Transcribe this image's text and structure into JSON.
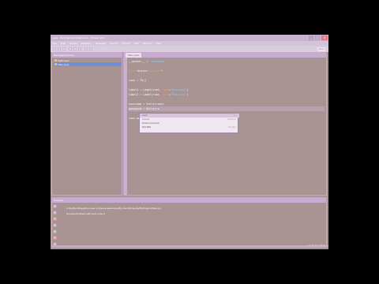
{
  "window": {
    "title": "Java - MyProject/src/Main.java - Eclipse SDK",
    "controls": [
      "_",
      "□",
      "x"
    ]
  },
  "menubar": {
    "items": [
      "File",
      "Edit",
      "Source",
      "Refactor",
      "Navigate",
      "Search",
      "Project",
      "Run",
      "Window",
      "Help"
    ]
  },
  "toolbar": {
    "perspective_label": "Java"
  },
  "package_explorer": {
    "title": "Package Explorer",
    "items": [
      {
        "label": "MyProject",
        "selected": false
      },
      {
        "label": "Main.java",
        "selected": true
      }
    ]
  },
  "editor": {
    "tab_label": "Main.java",
    "lines": [
      {
        "parts": [
          {
            "t": "   __author__ = ",
            "c": ""
          },
          {
            "t": "'username'",
            "c": "st"
          }
        ],
        "hl": false
      },
      {
        "parts": [],
        "hl": false
      },
      {
        "parts": [
          {
            "t": "from ",
            "c": "kw"
          },
          {
            "t": "tkinter ",
            "c": ""
          },
          {
            "t": "import",
            "c": "kw"
          },
          {
            "t": " *",
            "c": ""
          }
        ],
        "hl": false
      },
      {
        "parts": [],
        "hl": false
      },
      {
        "parts": [
          {
            "t": "root = Tk()",
            "c": ""
          }
        ],
        "hl": false
      },
      {
        "parts": [],
        "hl": false
      },
      {
        "parts": [
          {
            "t": "label1 = Label(root, ",
            "c": ""
          },
          {
            "t": "text",
            "c": "kw"
          },
          {
            "t": "=",
            "c": ""
          },
          {
            "t": "\"Username\"",
            "c": "st"
          },
          {
            "t": ")",
            "c": ""
          }
        ],
        "hl": false
      },
      {
        "parts": [
          {
            "t": "label2 = Label(root, ",
            "c": ""
          },
          {
            "t": "text",
            "c": "kw"
          },
          {
            "t": "=",
            "c": ""
          },
          {
            "t": "\"Password\"",
            "c": "st"
          },
          {
            "t": ")",
            "c": ""
          }
        ],
        "hl": false
      },
      {
        "parts": [],
        "hl": false
      },
      {
        "parts": [
          {
            "t": "username = Entry(root)",
            "c": ""
          }
        ],
        "hl": false
      },
      {
        "parts": [
          {
            "t": "password = Entry(ro",
            "c": ""
          }
        ],
        "hl": true
      },
      {
        "parts": [],
        "hl": false
      },
      {
        "parts": [
          {
            "t": "root.mainloop()",
            "c": ""
          }
        ],
        "hl": false
      }
    ]
  },
  "autocomplete": {
    "items": [
      {
        "label": "root",
        "hint": "Tk",
        "selected": true
      },
      {
        "label": "round",
        "hint": "builtins",
        "selected": false
      },
      {
        "label": "RowConstraint",
        "hint": "",
        "selected": false
      },
      {
        "label": "ROUND",
        "hint": "tkinter",
        "selected": false
      }
    ]
  },
  "console": {
    "title": "Console",
    "lines": [
      "C:\\Python34\\python.exe C:/Users/username/PycharmProjects/MyProject/Main.py",
      "Process finished with exit code 0"
    ]
  },
  "statusbar": {
    "text": "11:19   LF   UTF-8"
  },
  "colors": {
    "background": "#a99393",
    "chrome": "#c5acd0",
    "selection": "#6f8fd8"
  }
}
